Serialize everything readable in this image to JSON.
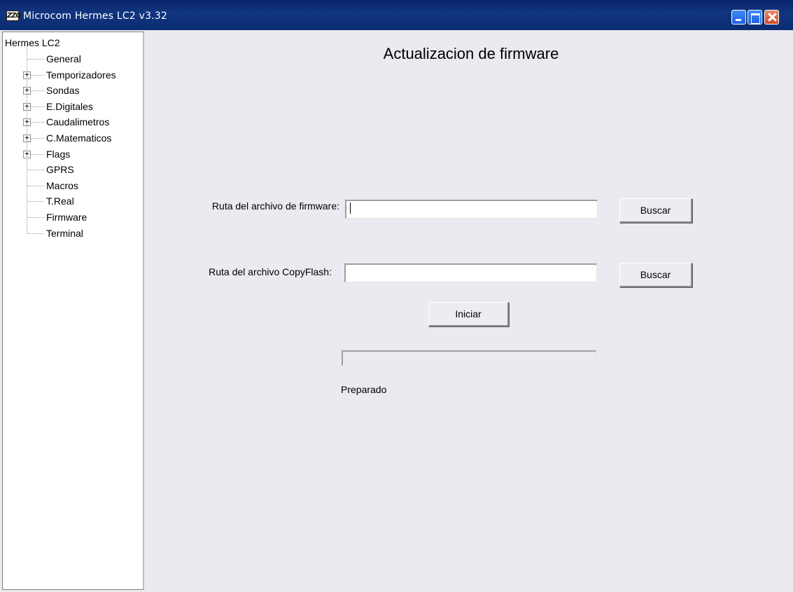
{
  "window": {
    "title": "Microcom Hermes LC2 v3.32",
    "icon_text": "ZZG"
  },
  "tree": {
    "root": "Hermes LC2",
    "items": [
      {
        "label": "General",
        "expandable": false
      },
      {
        "label": "Temporizadores",
        "expandable": true
      },
      {
        "label": "Sondas",
        "expandable": true
      },
      {
        "label": "E.Digitales",
        "expandable": true
      },
      {
        "label": "Caudalimetros",
        "expandable": true
      },
      {
        "label": "C.Matematicos",
        "expandable": true
      },
      {
        "label": "Flags",
        "expandable": true
      },
      {
        "label": "GPRS",
        "expandable": false
      },
      {
        "label": "Macros",
        "expandable": false
      },
      {
        "label": "T.Real",
        "expandable": false
      },
      {
        "label": "Firmware",
        "expandable": false
      },
      {
        "label": "Terminal",
        "expandable": false
      }
    ],
    "expander_symbol": "+"
  },
  "main": {
    "title": "Actualizacion de firmware",
    "firmware_label": "Ruta del archivo de firmware:",
    "firmware_value": "",
    "firmware_browse": "Buscar",
    "copyflash_label": "Ruta del archivo CopyFlash:",
    "copyflash_value": "",
    "copyflash_browse": "Buscar",
    "start_label": "Iniciar",
    "progress_percent": 0,
    "status": "Preparado"
  }
}
